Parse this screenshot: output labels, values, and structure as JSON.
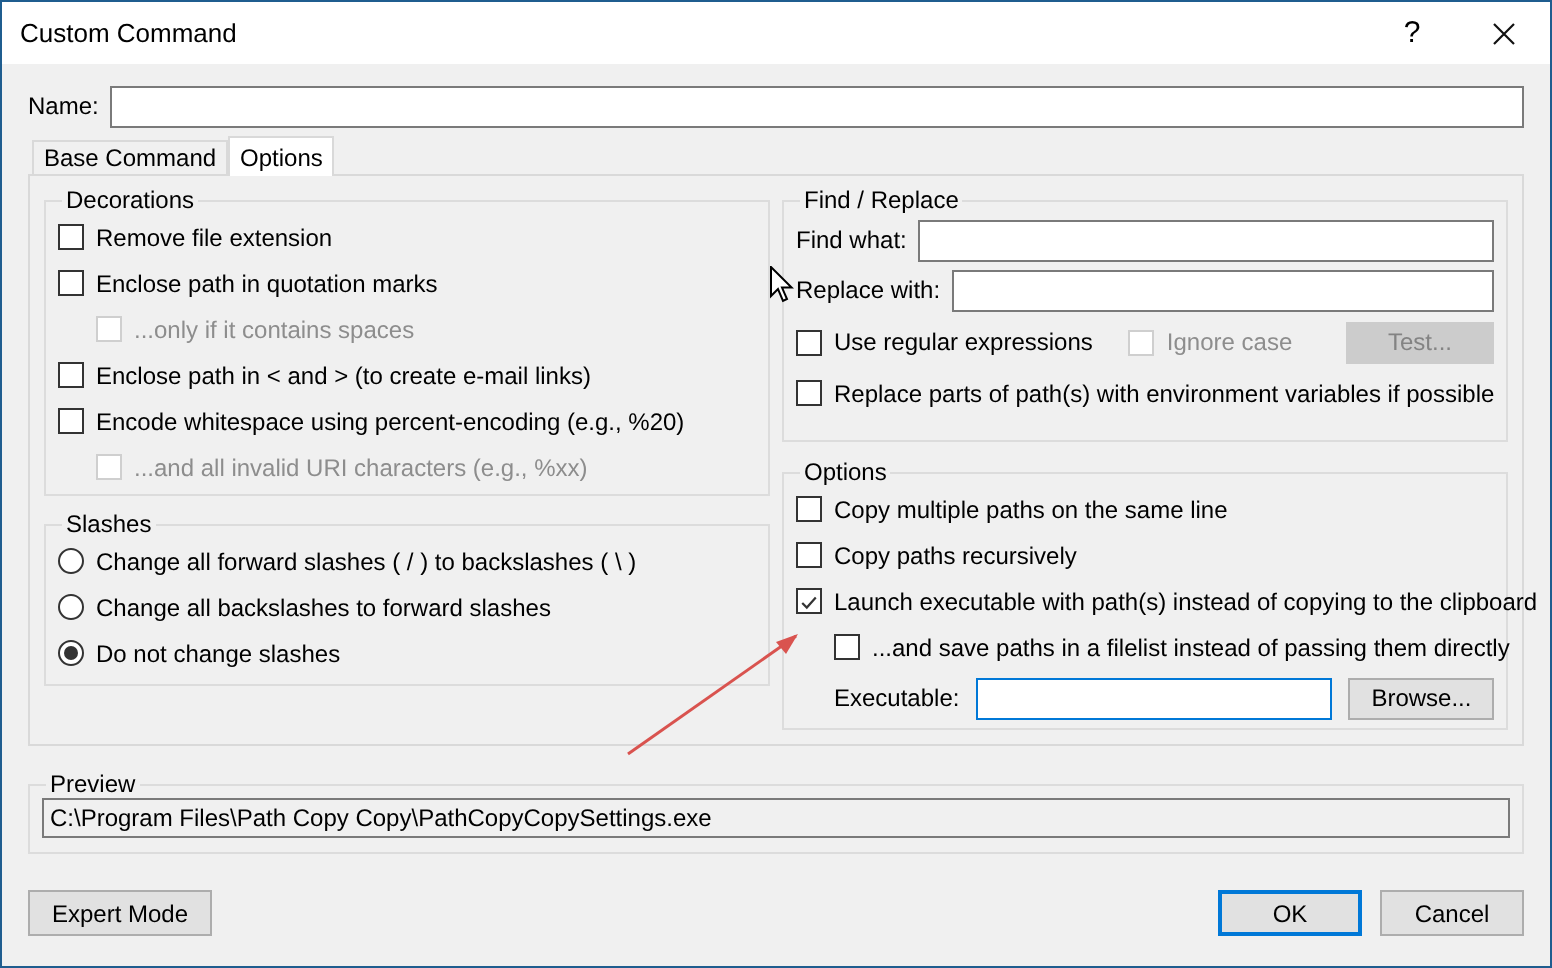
{
  "window": {
    "title": "Custom Command",
    "help": "?"
  },
  "name_field": {
    "label": "Name:"
  },
  "tabs": [
    {
      "label": "Base Command",
      "selected": false
    },
    {
      "label": "Options",
      "selected": true
    }
  ],
  "decorations": {
    "title": "Decorations",
    "items": [
      {
        "label": "Remove file extension",
        "checked": false,
        "disabled": false
      },
      {
        "label": "Enclose path in quotation marks",
        "checked": false,
        "disabled": false,
        "children": [
          {
            "label": "...only if it contains spaces",
            "checked": false,
            "disabled": true
          }
        ]
      },
      {
        "label": "Enclose path in < and > (to create e-mail links)",
        "checked": false,
        "disabled": false
      },
      {
        "label": "Encode whitespace using percent-encoding (e.g., %20)",
        "checked": false,
        "disabled": false,
        "children": [
          {
            "label": "...and all invalid URI characters (e.g., %xx)",
            "checked": false,
            "disabled": true
          }
        ]
      }
    ]
  },
  "slashes": {
    "title": "Slashes",
    "options": [
      {
        "label": "Change all forward slashes ( / ) to backslashes ( \\ )",
        "selected": false
      },
      {
        "label": "Change all backslashes to forward slashes",
        "selected": false
      },
      {
        "label": "Do not change slashes",
        "selected": true
      }
    ]
  },
  "find_replace": {
    "title": "Find / Replace",
    "find_label": "Find what:",
    "replace_label": "Replace with:",
    "checks": [
      {
        "label": "Use regular expressions",
        "checked": false,
        "disabled": false
      },
      {
        "label": "Ignore case",
        "checked": false,
        "disabled": true
      }
    ],
    "test_button": {
      "label": "Test...",
      "disabled": true
    },
    "env_check": {
      "label": "Replace parts of path(s) with environment variables if possible",
      "checked": false,
      "disabled": false
    }
  },
  "options": {
    "title": "Options",
    "items": [
      {
        "label": "Copy multiple paths on the same line",
        "checked": false,
        "disabled": false
      },
      {
        "label": "Copy paths recursively",
        "checked": false,
        "disabled": false
      },
      {
        "label": "Launch executable with path(s) instead of copying to the clipboard",
        "checked": true,
        "disabled": false,
        "children": [
          {
            "label": "...and save paths in a filelist instead of passing them directly",
            "checked": false,
            "disabled": false
          }
        ]
      }
    ],
    "executable": {
      "label": "Executable:",
      "focused": true
    },
    "browse_button": "Browse..."
  },
  "preview": {
    "title": "Preview",
    "value": "C:\\Program Files\\Path Copy Copy\\PathCopyCopySettings.exe"
  },
  "footer": {
    "expert_button": "Expert Mode",
    "ok_button": "OK",
    "cancel_button": "Cancel"
  }
}
